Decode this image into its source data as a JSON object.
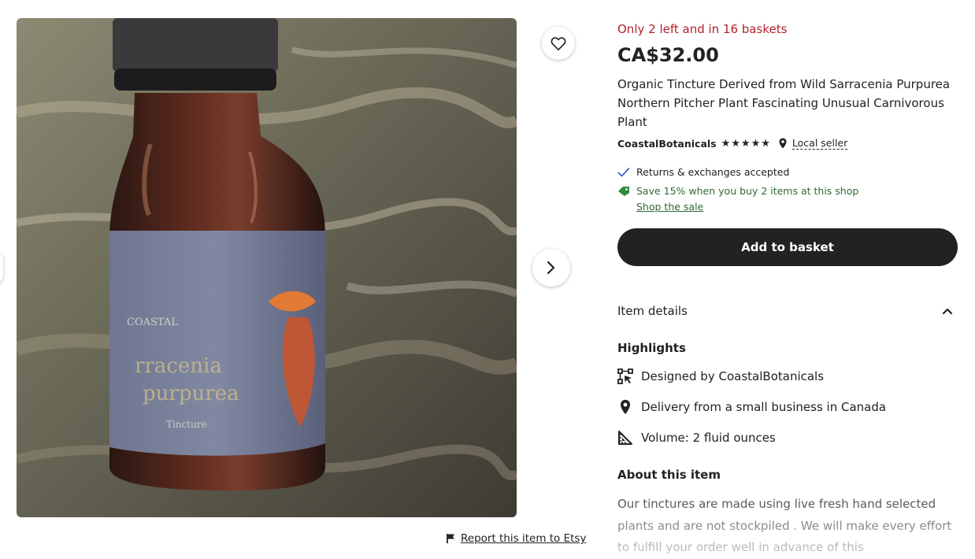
{
  "listing": {
    "stock_notice": "Only 2 left and in 16 baskets",
    "price": "CA$32.00",
    "title": "Organic Tincture Derived from Wild Sarracenia Purpurea Northern Pitcher Plant Fascinating Unusual Carnivorous Plant",
    "shop_name": "CoastalBotanicals",
    "rating_stars": "★★★★★",
    "rating_value": 5,
    "local_seller": "Local seller"
  },
  "perks": {
    "returns": "Returns & exchanges accepted",
    "sale": "Save 15% when you buy 2 items at this shop",
    "sale_link": "Shop the sale"
  },
  "actions": {
    "add_to_basket": "Add to basket",
    "report": "Report this item to Etsy"
  },
  "details": {
    "heading": "Item details",
    "highlights_heading": "Highlights",
    "designed_by_prefix": "Designed by",
    "designed_by_shop": "CoastalBotanicals",
    "delivery": "Delivery from a small business in Canada",
    "volume": "Volume: 2 fluid ounces",
    "about_heading": "About this item",
    "about_text": "Our tinctures are made using live fresh hand selected plants and are not stockpiled . We will make every effort to fulfill your order well in advance of this"
  },
  "colors": {
    "stock_red": "#b1232c",
    "button_dark": "#222222",
    "sale_green": "#2f6a3a",
    "check_blue": "#3b67c9"
  },
  "icons": [
    "heart-icon",
    "chevron-right-icon",
    "flag-icon",
    "map-pin-icon",
    "checkmark-icon",
    "tag-icon",
    "chevron-up-icon",
    "designer-icon",
    "ruler-triangle-icon"
  ]
}
